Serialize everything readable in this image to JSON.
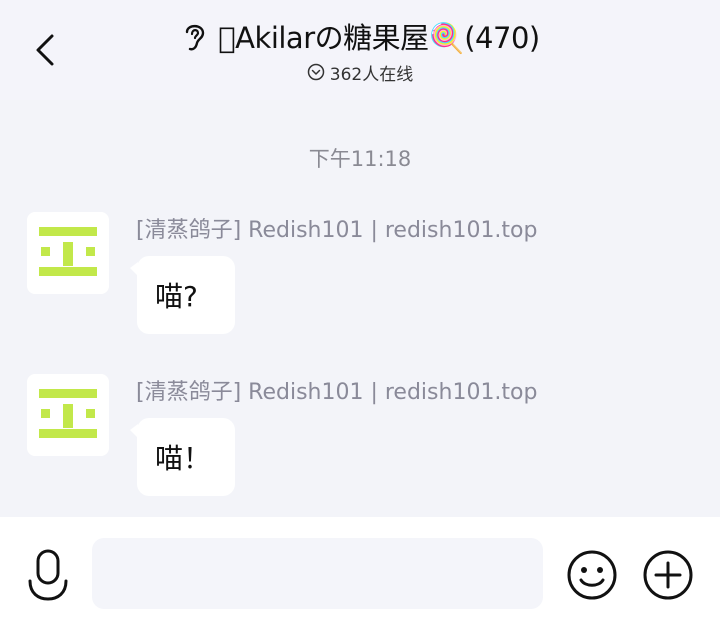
{
  "header": {
    "title": "\u0000Akilarの糖果屋🍭(470)",
    "online": "362人在线",
    "icons": {
      "back": "back-chevron-icon",
      "ear": "ear-icon",
      "online": "chevron-down-circle-icon"
    }
  },
  "chat": {
    "timestamp": "下午11:18",
    "messages": [
      {
        "sender": "[清蒸鸽子] Redish101 | redish101.top",
        "text": "喵?",
        "avatar": "pixel-face-avatar"
      },
      {
        "sender": "[清蒸鸽子] Redish101 | redish101.top",
        "text": "喵！",
        "avatar": "pixel-face-avatar"
      }
    ]
  },
  "input_bar": {
    "placeholder": "",
    "value": "",
    "icons": {
      "mic": "microphone-icon",
      "emoji": "smiley-face-icon",
      "plus": "plus-circle-icon"
    }
  },
  "colors": {
    "background": "#f3f4f9",
    "bubble": "#ffffff",
    "avatar_accent": "#c2e84a",
    "meta_text": "#8a8a99"
  }
}
